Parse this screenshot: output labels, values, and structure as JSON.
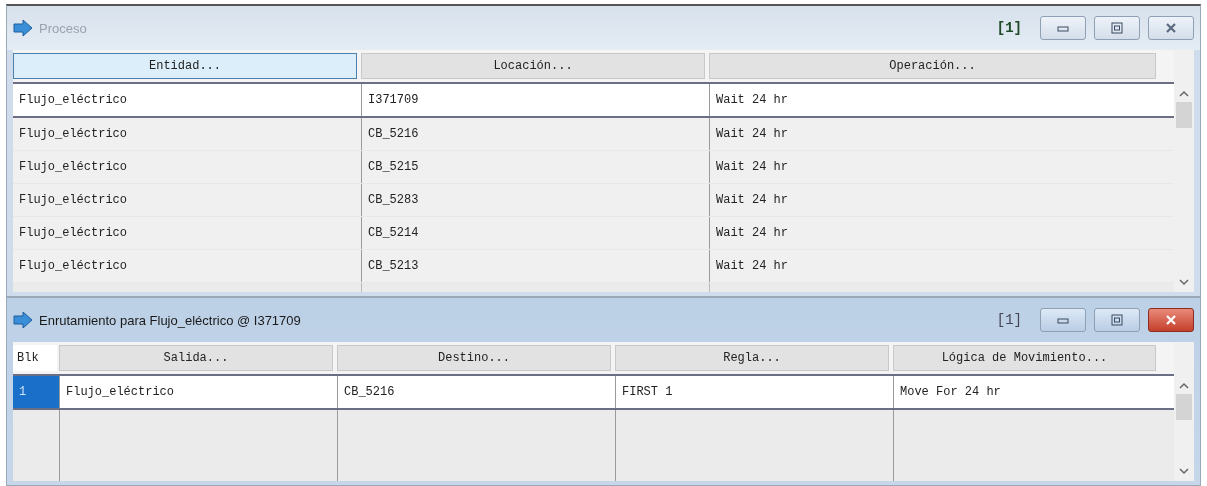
{
  "windows": [
    {
      "title": "Proceso",
      "active": false,
      "count": "[1]",
      "columns": [
        {
          "label": "Entidad...",
          "selected": true
        },
        {
          "label": "Locación...",
          "selected": false
        },
        {
          "label": "Operación...",
          "selected": false
        }
      ],
      "rows": [
        {
          "selected": true,
          "cells": [
            "Flujo_eléctrico",
            "I371709",
            "Wait 24 hr"
          ]
        },
        {
          "selected": false,
          "cells": [
            "Flujo_eléctrico",
            "CB_5216",
            "Wait 24 hr"
          ]
        },
        {
          "selected": false,
          "cells": [
            "Flujo_eléctrico",
            "CB_5215",
            "Wait 24 hr"
          ]
        },
        {
          "selected": false,
          "cells": [
            "Flujo_eléctrico",
            "CB_5283",
            "Wait 24 hr"
          ]
        },
        {
          "selected": false,
          "cells": [
            "Flujo_eléctrico",
            "CB_5214",
            "Wait 24 hr"
          ]
        },
        {
          "selected": false,
          "cells": [
            "Flujo_eléctrico",
            "CB_5213",
            "Wait 24 hr"
          ]
        }
      ]
    },
    {
      "title": "Enrutamiento para Flujo_eléctrico @ I371709",
      "active": true,
      "count": "[1]",
      "block_header": "Blk",
      "columns": [
        {
          "label": "Salida...",
          "selected": false
        },
        {
          "label": "Destino...",
          "selected": false
        },
        {
          "label": "Regla...",
          "selected": false
        },
        {
          "label": "Lógica de Movimiento...",
          "selected": false
        }
      ],
      "rows": [
        {
          "selected": true,
          "block": "1",
          "cells": [
            "Flujo_eléctrico",
            "CB_5216",
            "FIRST 1",
            "Move For 24 hr"
          ]
        }
      ]
    }
  ]
}
